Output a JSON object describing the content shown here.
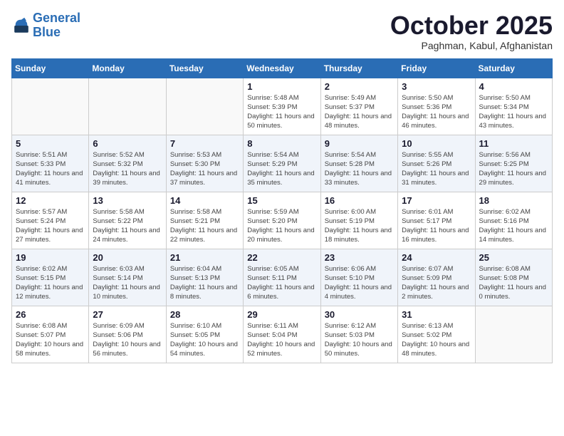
{
  "header": {
    "logo_line1": "General",
    "logo_line2": "Blue",
    "month": "October 2025",
    "location": "Paghman, Kabul, Afghanistan"
  },
  "weekdays": [
    "Sunday",
    "Monday",
    "Tuesday",
    "Wednesday",
    "Thursday",
    "Friday",
    "Saturday"
  ],
  "weeks": [
    [
      {
        "day": "",
        "sunrise": "",
        "sunset": "",
        "daylight": ""
      },
      {
        "day": "",
        "sunrise": "",
        "sunset": "",
        "daylight": ""
      },
      {
        "day": "",
        "sunrise": "",
        "sunset": "",
        "daylight": ""
      },
      {
        "day": "1",
        "sunrise": "Sunrise: 5:48 AM",
        "sunset": "Sunset: 5:39 PM",
        "daylight": "Daylight: 11 hours and 50 minutes."
      },
      {
        "day": "2",
        "sunrise": "Sunrise: 5:49 AM",
        "sunset": "Sunset: 5:37 PM",
        "daylight": "Daylight: 11 hours and 48 minutes."
      },
      {
        "day": "3",
        "sunrise": "Sunrise: 5:50 AM",
        "sunset": "Sunset: 5:36 PM",
        "daylight": "Daylight: 11 hours and 46 minutes."
      },
      {
        "day": "4",
        "sunrise": "Sunrise: 5:50 AM",
        "sunset": "Sunset: 5:34 PM",
        "daylight": "Daylight: 11 hours and 43 minutes."
      }
    ],
    [
      {
        "day": "5",
        "sunrise": "Sunrise: 5:51 AM",
        "sunset": "Sunset: 5:33 PM",
        "daylight": "Daylight: 11 hours and 41 minutes."
      },
      {
        "day": "6",
        "sunrise": "Sunrise: 5:52 AM",
        "sunset": "Sunset: 5:32 PM",
        "daylight": "Daylight: 11 hours and 39 minutes."
      },
      {
        "day": "7",
        "sunrise": "Sunrise: 5:53 AM",
        "sunset": "Sunset: 5:30 PM",
        "daylight": "Daylight: 11 hours and 37 minutes."
      },
      {
        "day": "8",
        "sunrise": "Sunrise: 5:54 AM",
        "sunset": "Sunset: 5:29 PM",
        "daylight": "Daylight: 11 hours and 35 minutes."
      },
      {
        "day": "9",
        "sunrise": "Sunrise: 5:54 AM",
        "sunset": "Sunset: 5:28 PM",
        "daylight": "Daylight: 11 hours and 33 minutes."
      },
      {
        "day": "10",
        "sunrise": "Sunrise: 5:55 AM",
        "sunset": "Sunset: 5:26 PM",
        "daylight": "Daylight: 11 hours and 31 minutes."
      },
      {
        "day": "11",
        "sunrise": "Sunrise: 5:56 AM",
        "sunset": "Sunset: 5:25 PM",
        "daylight": "Daylight: 11 hours and 29 minutes."
      }
    ],
    [
      {
        "day": "12",
        "sunrise": "Sunrise: 5:57 AM",
        "sunset": "Sunset: 5:24 PM",
        "daylight": "Daylight: 11 hours and 27 minutes."
      },
      {
        "day": "13",
        "sunrise": "Sunrise: 5:58 AM",
        "sunset": "Sunset: 5:22 PM",
        "daylight": "Daylight: 11 hours and 24 minutes."
      },
      {
        "day": "14",
        "sunrise": "Sunrise: 5:58 AM",
        "sunset": "Sunset: 5:21 PM",
        "daylight": "Daylight: 11 hours and 22 minutes."
      },
      {
        "day": "15",
        "sunrise": "Sunrise: 5:59 AM",
        "sunset": "Sunset: 5:20 PM",
        "daylight": "Daylight: 11 hours and 20 minutes."
      },
      {
        "day": "16",
        "sunrise": "Sunrise: 6:00 AM",
        "sunset": "Sunset: 5:19 PM",
        "daylight": "Daylight: 11 hours and 18 minutes."
      },
      {
        "day": "17",
        "sunrise": "Sunrise: 6:01 AM",
        "sunset": "Sunset: 5:17 PM",
        "daylight": "Daylight: 11 hours and 16 minutes."
      },
      {
        "day": "18",
        "sunrise": "Sunrise: 6:02 AM",
        "sunset": "Sunset: 5:16 PM",
        "daylight": "Daylight: 11 hours and 14 minutes."
      }
    ],
    [
      {
        "day": "19",
        "sunrise": "Sunrise: 6:02 AM",
        "sunset": "Sunset: 5:15 PM",
        "daylight": "Daylight: 11 hours and 12 minutes."
      },
      {
        "day": "20",
        "sunrise": "Sunrise: 6:03 AM",
        "sunset": "Sunset: 5:14 PM",
        "daylight": "Daylight: 11 hours and 10 minutes."
      },
      {
        "day": "21",
        "sunrise": "Sunrise: 6:04 AM",
        "sunset": "Sunset: 5:13 PM",
        "daylight": "Daylight: 11 hours and 8 minutes."
      },
      {
        "day": "22",
        "sunrise": "Sunrise: 6:05 AM",
        "sunset": "Sunset: 5:11 PM",
        "daylight": "Daylight: 11 hours and 6 minutes."
      },
      {
        "day": "23",
        "sunrise": "Sunrise: 6:06 AM",
        "sunset": "Sunset: 5:10 PM",
        "daylight": "Daylight: 11 hours and 4 minutes."
      },
      {
        "day": "24",
        "sunrise": "Sunrise: 6:07 AM",
        "sunset": "Sunset: 5:09 PM",
        "daylight": "Daylight: 11 hours and 2 minutes."
      },
      {
        "day": "25",
        "sunrise": "Sunrise: 6:08 AM",
        "sunset": "Sunset: 5:08 PM",
        "daylight": "Daylight: 11 hours and 0 minutes."
      }
    ],
    [
      {
        "day": "26",
        "sunrise": "Sunrise: 6:08 AM",
        "sunset": "Sunset: 5:07 PM",
        "daylight": "Daylight: 10 hours and 58 minutes."
      },
      {
        "day": "27",
        "sunrise": "Sunrise: 6:09 AM",
        "sunset": "Sunset: 5:06 PM",
        "daylight": "Daylight: 10 hours and 56 minutes."
      },
      {
        "day": "28",
        "sunrise": "Sunrise: 6:10 AM",
        "sunset": "Sunset: 5:05 PM",
        "daylight": "Daylight: 10 hours and 54 minutes."
      },
      {
        "day": "29",
        "sunrise": "Sunrise: 6:11 AM",
        "sunset": "Sunset: 5:04 PM",
        "daylight": "Daylight: 10 hours and 52 minutes."
      },
      {
        "day": "30",
        "sunrise": "Sunrise: 6:12 AM",
        "sunset": "Sunset: 5:03 PM",
        "daylight": "Daylight: 10 hours and 50 minutes."
      },
      {
        "day": "31",
        "sunrise": "Sunrise: 6:13 AM",
        "sunset": "Sunset: 5:02 PM",
        "daylight": "Daylight: 10 hours and 48 minutes."
      },
      {
        "day": "",
        "sunrise": "",
        "sunset": "",
        "daylight": ""
      }
    ]
  ]
}
